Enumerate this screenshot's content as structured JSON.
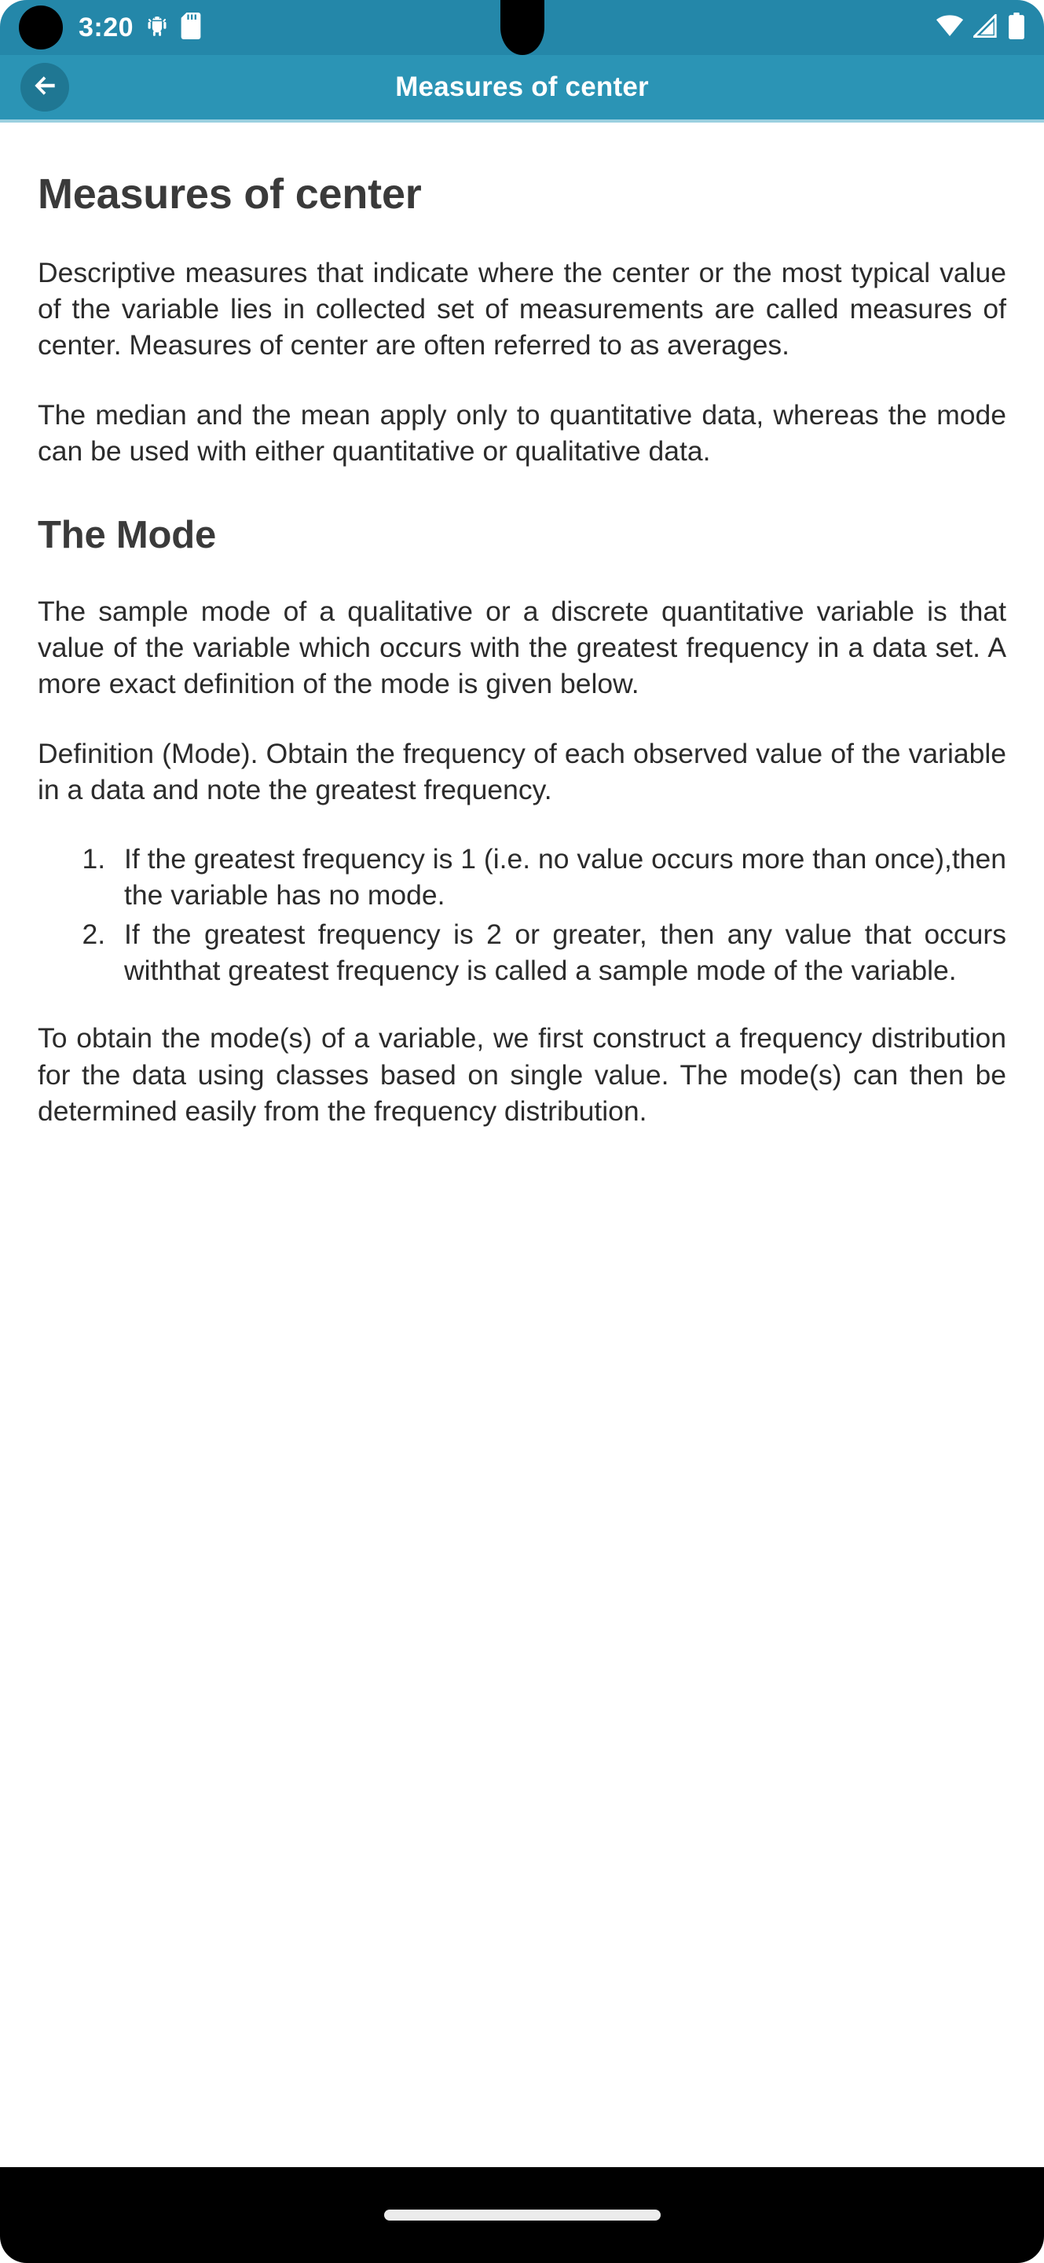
{
  "status_bar": {
    "time": "3:20",
    "icons": {
      "camera_punch": "camera-punch-hole",
      "debug": "android-debug-icon",
      "sd_card": "sd-card-icon",
      "wifi": "wifi-icon",
      "signal": "cellular-signal-icon",
      "battery": "battery-icon"
    },
    "background_color": "#2487a9"
  },
  "app_bar": {
    "title": "Measures of center",
    "back_icon": "arrow-left-icon",
    "background_color": "#2b94b5",
    "back_button_color": "#1f7793",
    "title_color": "#ffffff"
  },
  "content": {
    "title": "Measures of center",
    "paragraph_1": "Descriptive measures that indicate where the center or the most typical value of the variable lies in collected set of measurements are called measures of center. Measures of center are often referred to as averages.",
    "paragraph_2": "The median and the mean apply only to quantitative data, whereas the mode can be used with either quantitative or qualitative data.",
    "heading_mode": "The Mode",
    "paragraph_3": "The sample mode of a qualitative or a discrete quantitative variable is that value of the variable which occurs with the greatest frequency in a data set. A more exact definition of the mode is given below.",
    "paragraph_4": "Definition (Mode). Obtain the frequency of each observed value of the variable in a data and note the greatest frequency.",
    "list_items": [
      "If the greatest frequency is 1 (i.e. no value occurs more than once),then the variable has no mode.",
      "If the greatest frequency is 2 or greater, then any value that occurs withthat greatest frequency is called a sample mode of the variable."
    ],
    "paragraph_5": "To obtain the mode(s) of a variable, we first construct a frequency distribution for the data using classes based on single value. The mode(s) can then be determined easily from the frequency distribution.",
    "text_color": "#2b2b2b",
    "heading_color": "#3a3a3a"
  },
  "nav_bar": {
    "home_indicator": "home-indicator-pill",
    "background_color": "#000000"
  }
}
